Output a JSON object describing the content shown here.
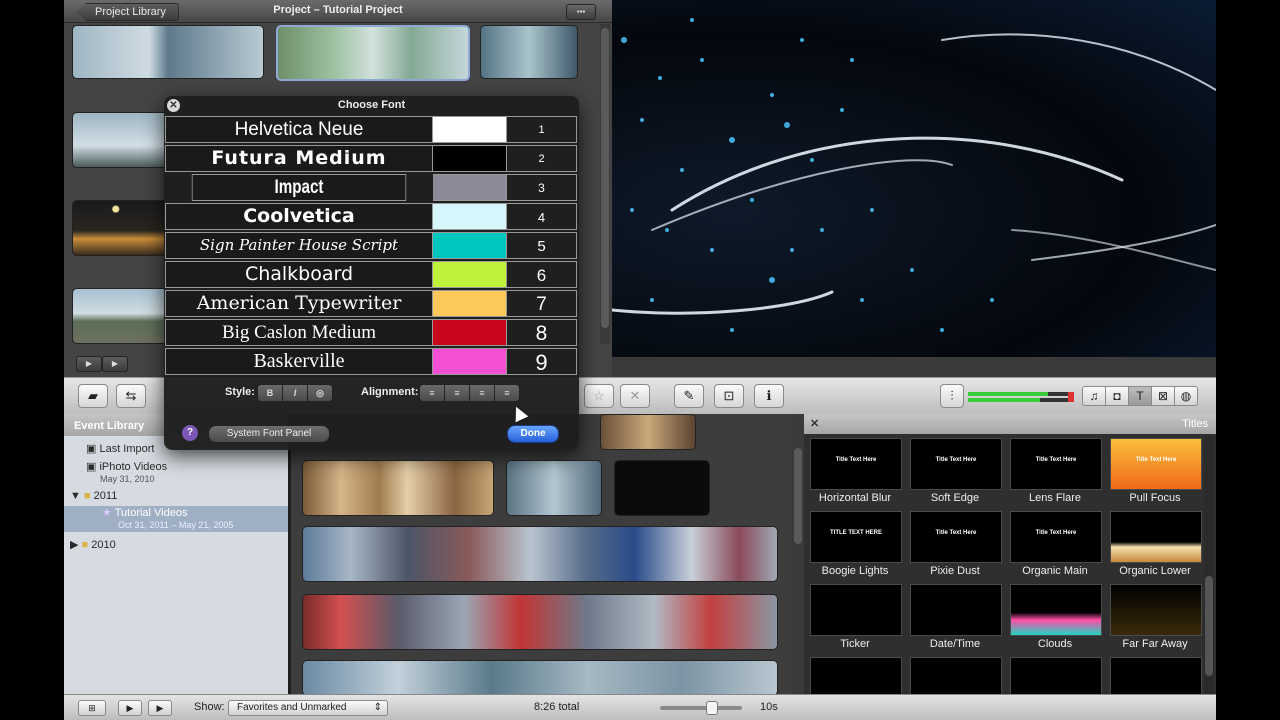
{
  "project": {
    "back_label": "Project Library",
    "title": "Project – Tutorial Project"
  },
  "font_panel": {
    "title": "Choose Font",
    "fonts": [
      {
        "name": "Helvetica Neue",
        "color": "#ffffff",
        "number": "1"
      },
      {
        "name": "Futura Medium",
        "color": "#000000",
        "number": "2"
      },
      {
        "name": "Impact",
        "color": "#8a8a98",
        "number": "3"
      },
      {
        "name": "Coolvetica",
        "color": "#d6f6fb",
        "number": "4"
      },
      {
        "name": "Sign Painter House Script",
        "color": "#00c6c0",
        "number": "5"
      },
      {
        "name": "Chalkboard",
        "color": "#c0f23c",
        "number": "6"
      },
      {
        "name": "American Typewriter",
        "color": "#fcc859",
        "number": "7"
      },
      {
        "name": "Big Caslon Medium",
        "color": "#c8071c",
        "number": "8"
      },
      {
        "name": "Baskerville",
        "color": "#f54fd3",
        "number": "9"
      }
    ],
    "style_label": "Style:",
    "style_buttons": [
      "B",
      "I",
      "◎"
    ],
    "alignment_label": "Alignment:",
    "system_font_label": "System Font Panel",
    "help_label": "?",
    "done_label": "Done"
  },
  "event_library": {
    "header": "Event Library",
    "items": [
      {
        "label": "Last Import",
        "sub": ""
      },
      {
        "label": "iPhoto Videos",
        "sub": "May 31, 2010"
      },
      {
        "label": "2011",
        "sub": ""
      },
      {
        "label": "Tutorial Videos",
        "sub": "Oct 31, 2011 – May 21, 2005"
      },
      {
        "label": "2010",
        "sub": ""
      }
    ]
  },
  "titles": {
    "header": "Titles",
    "items": [
      {
        "label": "Horizontal Blur",
        "preview": "Title Text Here"
      },
      {
        "label": "Soft Edge",
        "preview": "Title Text Here"
      },
      {
        "label": "Lens Flare",
        "preview": "Title Text Here"
      },
      {
        "label": "Pull Focus",
        "preview": "Title Text Here"
      },
      {
        "label": "Boogie Lights",
        "preview": "TITLE TEXT HERE"
      },
      {
        "label": "Pixie Dust",
        "preview": "Title Text Here"
      },
      {
        "label": "Organic Main",
        "preview": "Title Text Here"
      },
      {
        "label": "Organic Lower",
        "preview": ""
      },
      {
        "label": "Ticker",
        "preview": ""
      },
      {
        "label": "Date/Time",
        "preview": ""
      },
      {
        "label": "Clouds",
        "preview": ""
      },
      {
        "label": "Far Far Away",
        "preview": ""
      }
    ]
  },
  "bottombar": {
    "show_label": "Show:",
    "show_value": "Favorites and Unmarked",
    "total": "8:26 total",
    "duration": "10s"
  }
}
